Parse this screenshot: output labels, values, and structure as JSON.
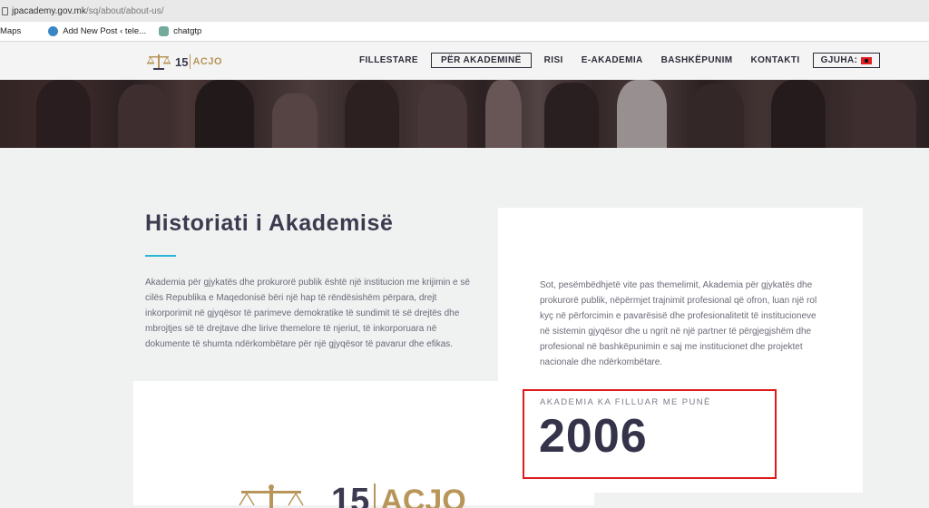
{
  "browser": {
    "url_host": "jpacademy.gov.mk",
    "url_path": "/sq/about/about-us/",
    "bookmarks": [
      {
        "label": "Maps",
        "icon": "maps-icon"
      },
      {
        "label": "Add New Post ‹ tele...",
        "icon": "wordpress-icon"
      },
      {
        "label": "chatgtp",
        "icon": "chatgpt-icon"
      }
    ]
  },
  "header": {
    "logo_number": "15",
    "logo_text": "ACJO",
    "nav": [
      {
        "label": "FILLESTARE"
      },
      {
        "label": "PËR AKADEMINË"
      },
      {
        "label": "RISI"
      },
      {
        "label": "E-AKADEMIA"
      },
      {
        "label": "BASHKËPUNIM"
      },
      {
        "label": "KONTAKTI"
      }
    ],
    "active_nav": "PËR AKADEMINË",
    "lang_label": "GJUHA:",
    "lang_flag": "albania-flag-icon"
  },
  "content": {
    "title": "Historiati i Akademisë",
    "left_paragraph": "Akademia për gjykatës dhe prokurorë publik është një institucion me krijimin e së cilës Republika e Maqedonisë bëri një hap të rëndësishëm përpara, drejt inkorporimit në gjyqësor të parimeve demokratike të sundimit të së drejtës dhe mbrojtjes së të drejtave dhe lirive themelore të njeriut, të inkorporuara në dokumente të shumta ndërkombëtare për një gjyqësor të pavarur dhe efikas.",
    "right_paragraph": "Sot, pesëmbëdhjetë vite pas themelimit, Akademia për gjykatës dhe prokurorë publik, nëpërmjet trajnimit profesional që ofron, luan një rol kyç në përforcimin e pavarësisë dhe profesionalitetit të institucioneve në sistemin gjyqësor dhe u ngrit në një partner të përgjegjshëm dhe profesional në bashkëpunimin e saj me institucionet dhe projektet nacionale dhe ndërkombëtare.",
    "stat_label": "AKADEMIA KA FILLUAR ME PUNË",
    "stat_value": "2006"
  },
  "colors": {
    "accent": "#29b6d8",
    "brand_dark": "#3b3a4f",
    "brand_gold": "#b8965a",
    "highlight": "#e01b1b"
  }
}
